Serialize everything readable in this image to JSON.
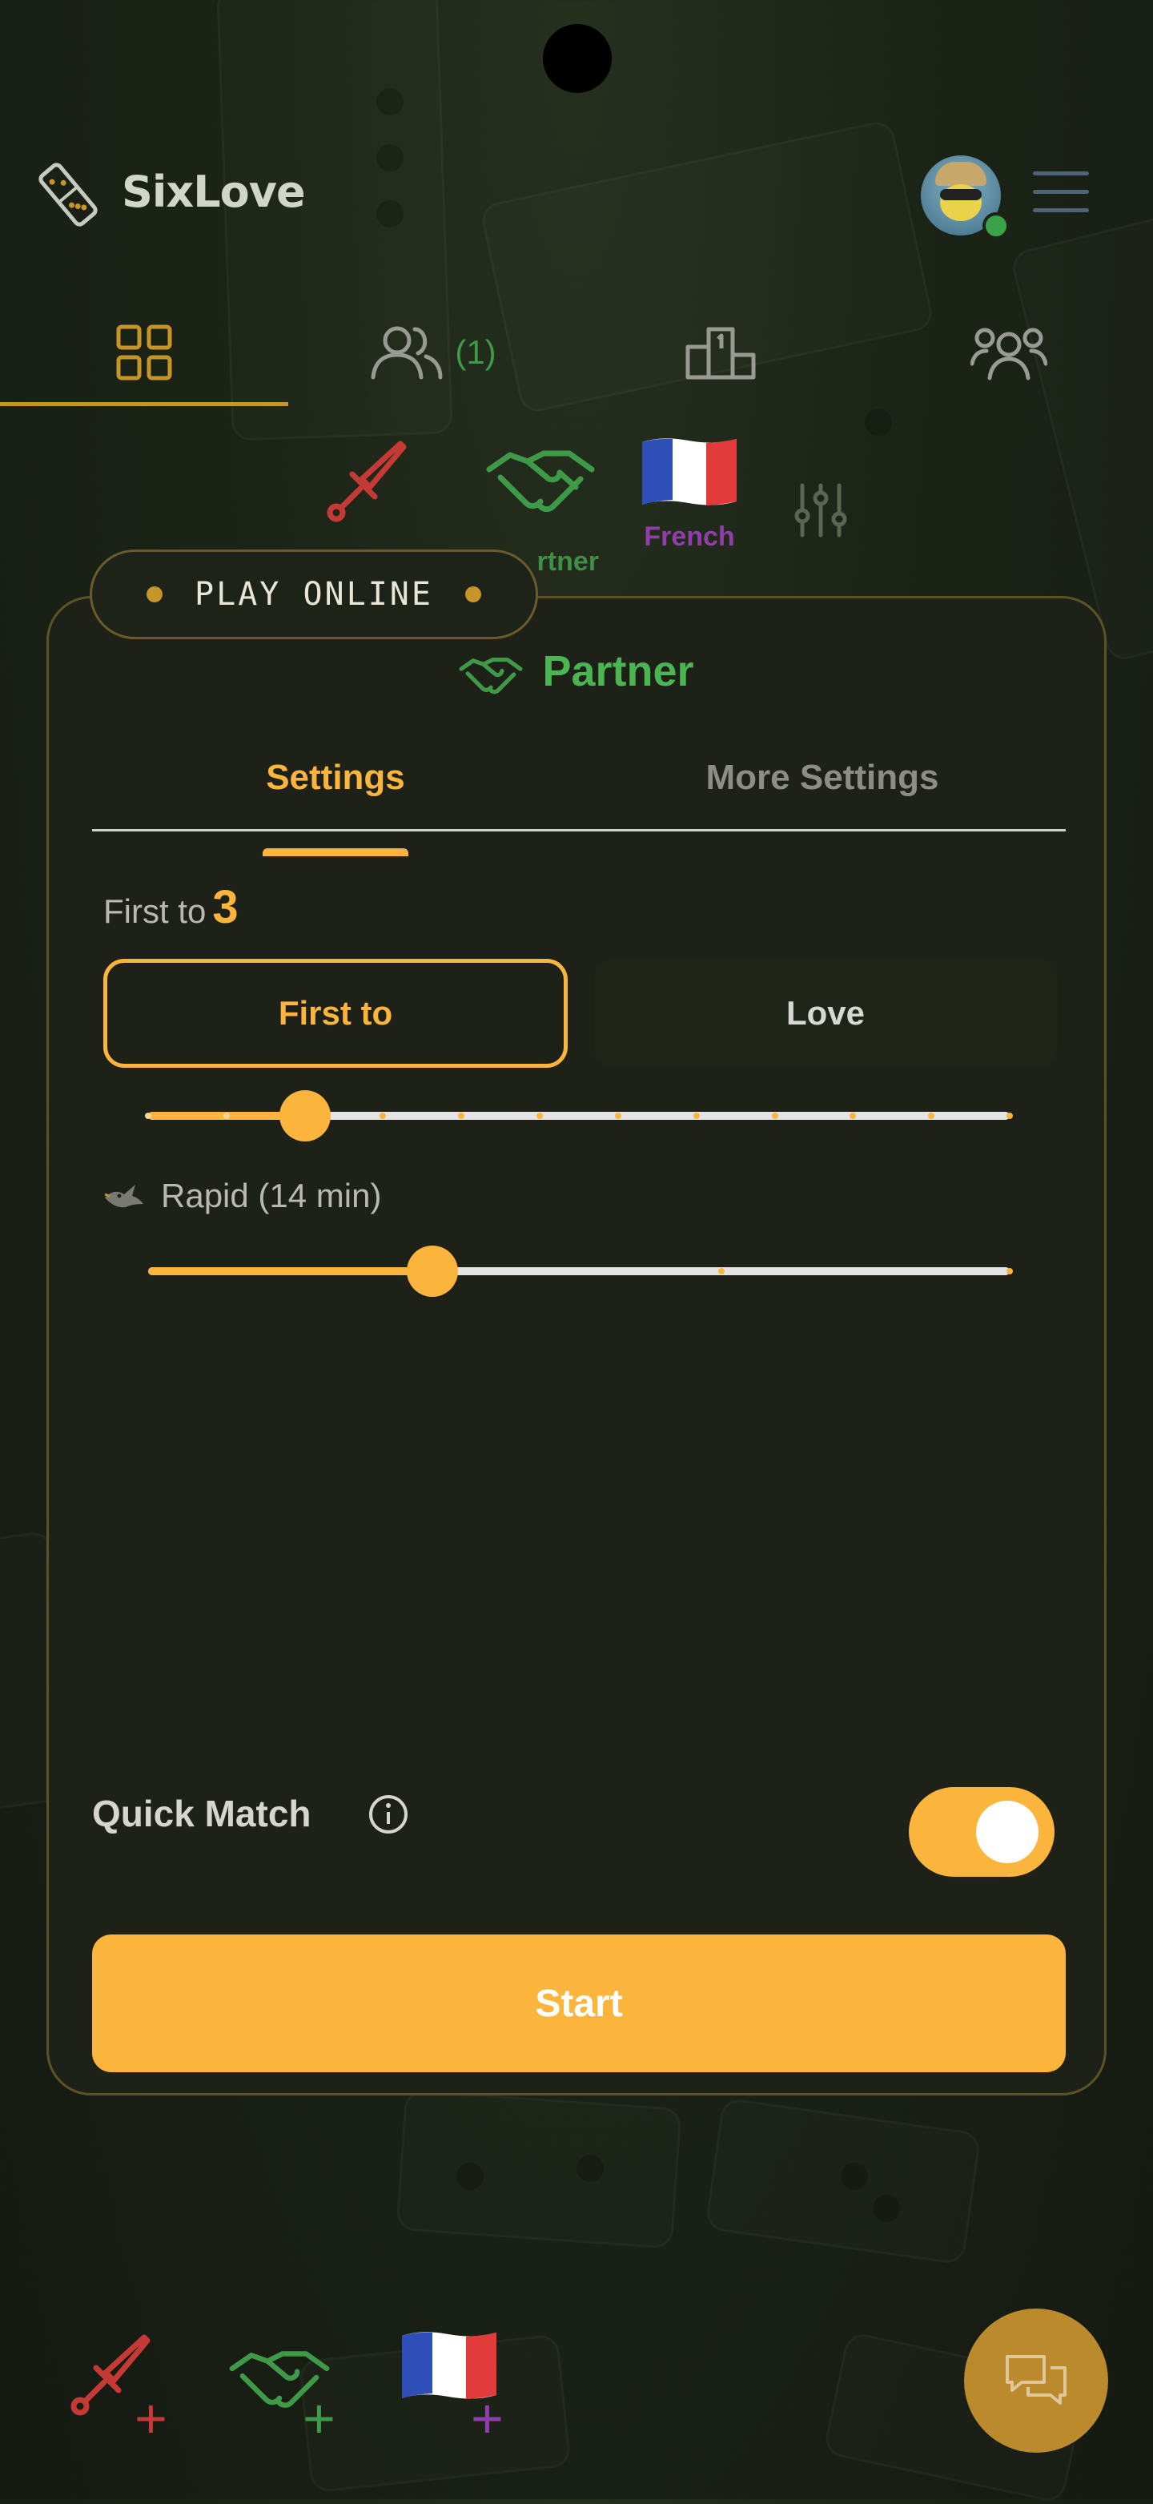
{
  "app": {
    "name": "SixLove"
  },
  "nav": {
    "tabs": [
      {
        "id": "games",
        "icon": "grid-icon"
      },
      {
        "id": "friends",
        "icon": "people-icon",
        "count": "(1)"
      },
      {
        "id": "leaderboard",
        "icon": "podium-icon"
      },
      {
        "id": "community",
        "icon": "group-icon"
      }
    ],
    "active": "games"
  },
  "modes": {
    "battle": {
      "icon": "sword-icon"
    },
    "partner": {
      "label": "rtner",
      "icon": "handshake-icon"
    },
    "french": {
      "label": "French",
      "icon": "french-flag-icon"
    },
    "settings": {
      "icon": "sliders-icon"
    }
  },
  "play_online": {
    "label": "PLAY ONLINE"
  },
  "card": {
    "title": "Partner",
    "tabs": {
      "settings": "Settings",
      "more": "More Settings"
    },
    "first_to": {
      "label": "First to",
      "value": "3"
    },
    "segment": {
      "first_to": "First to",
      "love": "Love"
    },
    "score_slider": {
      "value": 3,
      "min": 1,
      "max": 12
    },
    "rapid": {
      "label": "Rapid (14 min)"
    },
    "time_slider": {
      "fraction": 0.33
    },
    "quick_match": {
      "label": "Quick Match",
      "enabled": true
    },
    "start": "Start"
  },
  "colors": {
    "accent": "#fbb43c",
    "partner_green": "#4bb453",
    "battle_red": "#c63a36",
    "french_purple": "#8e3fa8"
  }
}
